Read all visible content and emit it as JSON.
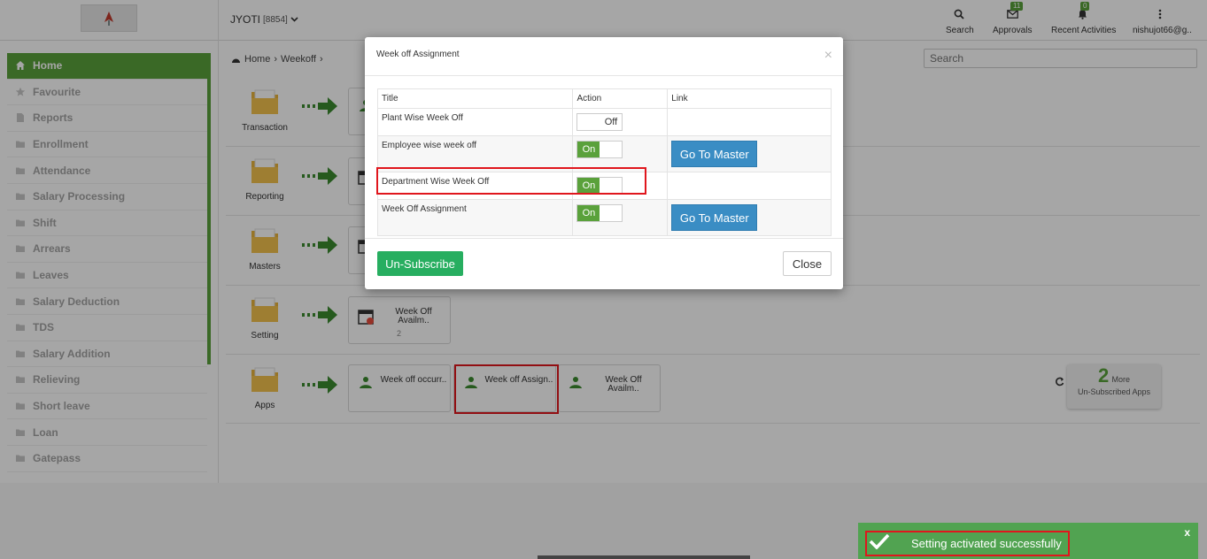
{
  "header": {
    "user_name": "JYOTI",
    "user_code": "[8854]",
    "search_label": "Search",
    "approvals_label": "Approvals",
    "approvals_count": "11",
    "recent_label": "Recent Activities",
    "recent_count": "0",
    "account_label": "nishujot66@g.."
  },
  "sidebar": {
    "items": [
      {
        "label": "Home"
      },
      {
        "label": "Favourite"
      },
      {
        "label": "Reports"
      },
      {
        "label": "Enrollment"
      },
      {
        "label": "Attendance"
      },
      {
        "label": "Salary Processing"
      },
      {
        "label": "Shift"
      },
      {
        "label": "Arrears"
      },
      {
        "label": "Leaves"
      },
      {
        "label": "Salary Deduction"
      },
      {
        "label": "TDS"
      },
      {
        "label": "Salary Addition"
      },
      {
        "label": "Relieving"
      },
      {
        "label": "Short leave"
      },
      {
        "label": "Loan"
      },
      {
        "label": "Gatepass"
      }
    ]
  },
  "breadcrumb": {
    "home": "Home",
    "current": "Weekoff"
  },
  "search": {
    "placeholder": "Search"
  },
  "categories": {
    "transaction": "Transaction",
    "reporting": "Reporting",
    "masters": "Masters",
    "setting": "Setting",
    "apps": "Apps"
  },
  "setting_card": {
    "title": "Week Off Availm..",
    "count": "2"
  },
  "apps_cards": [
    {
      "title": "Week off occurr.."
    },
    {
      "title": "Week off Assign.."
    },
    {
      "title": "Week Off Availm.."
    }
  ],
  "more": {
    "count": "2",
    "label": "More",
    "sub": "Un-Subscribed Apps"
  },
  "modal": {
    "title": "Week off Assignment",
    "close_symbol": "×",
    "columns": {
      "title": "Title",
      "action": "Action",
      "link": "Link"
    },
    "rows": [
      {
        "title": "Plant Wise Week Off",
        "state": "Off"
      },
      {
        "title": "Employee wise week off",
        "state": "On",
        "link": "Go To Master"
      },
      {
        "title": "Department Wise Week Off",
        "state": "On"
      },
      {
        "title": "Week Off Assignment",
        "state": "On",
        "link": "Go To Master"
      }
    ],
    "unsubscribe_label": "Un-Subscribe",
    "close_label": "Close"
  },
  "toast": {
    "message": "Setting activated successfully",
    "close_symbol": "x"
  },
  "colors": {
    "brand_green": "#5aa13b",
    "button_blue": "#3a8dc4",
    "toast_green": "#51a351",
    "highlight_red": "#e0161d"
  }
}
